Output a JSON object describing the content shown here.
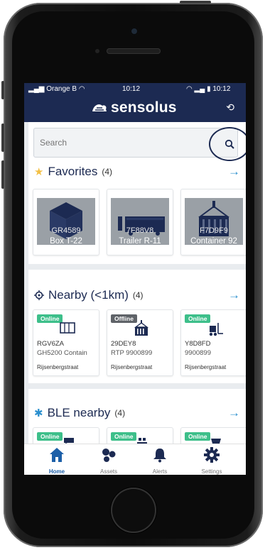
{
  "status_bar": {
    "carrier": "Orange B",
    "time": "10:12",
    "time_right": "10:12"
  },
  "header": {
    "logo_text": "sensolus",
    "refresh_icon": "refresh-icon"
  },
  "search": {
    "placeholder": "Search"
  },
  "favorites": {
    "title": "Favorites",
    "count": "(4)",
    "items": [
      {
        "id": "GR4589",
        "name": "Box T-22",
        "icon": "box-icon"
      },
      {
        "id": "7F88V8",
        "name": "Trailer R-11",
        "icon": "trailer-icon"
      },
      {
        "id": "F7D9F9",
        "name": "Container 92",
        "icon": "container-icon"
      }
    ]
  },
  "nearby": {
    "title": "Nearby (<1km)",
    "count": "(4)",
    "items": [
      {
        "status": "Online",
        "id": "RGV6ZA",
        "sub": "GH5200 Contain",
        "location": "Rijsenbergstraat",
        "icon": "container-icon"
      },
      {
        "status": "Offline",
        "id": "29DEY8",
        "sub": "RTP 9900899",
        "location": "Rijsenbergstraat",
        "icon": "container-icon"
      },
      {
        "status": "Online",
        "id": "Y8D8FD",
        "sub": "9900899",
        "location": "Rijsenbergstraat",
        "icon": "forklift-icon"
      }
    ]
  },
  "ble": {
    "title": "BLE nearby",
    "count": "(4)",
    "items": [
      {
        "status": "Online",
        "icon": "trailer-icon"
      },
      {
        "status": "Online",
        "icon": "pallet-icon"
      },
      {
        "status": "Online",
        "icon": "cart-icon"
      }
    ]
  },
  "tabs": [
    {
      "label": "Home",
      "icon": "home-icon",
      "active": true
    },
    {
      "label": "Assets",
      "icon": "assets-icon",
      "active": false
    },
    {
      "label": "Alerts",
      "icon": "bell-icon",
      "active": false
    },
    {
      "label": "Settings",
      "icon": "gear-icon",
      "active": false
    }
  ],
  "colors": {
    "brand": "#1c2a52",
    "accent": "#2a8fce",
    "online": "#3dbf8a",
    "offline": "#5f6368",
    "star": "#f3c046"
  }
}
